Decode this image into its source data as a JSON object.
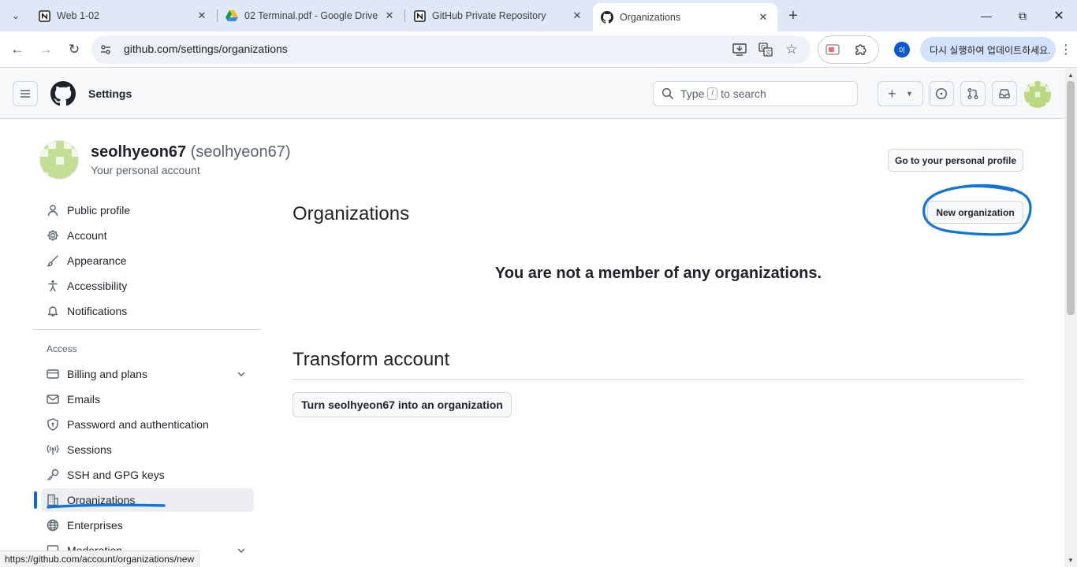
{
  "browser": {
    "tabs": [
      {
        "label": "Web 1-02",
        "icon": "notion-icon"
      },
      {
        "label": "02 Terminal.pdf - Google Drive",
        "icon": "google-drive-icon"
      },
      {
        "label": "GitHub Private Repository",
        "icon": "notion-icon"
      },
      {
        "label": "Organizations",
        "icon": "github-icon",
        "active": true
      }
    ],
    "url": "github.com/settings/organizations",
    "profile_initial": "이",
    "update_label": "다시 실행하여 업데이트하세요.",
    "status_url": "https://github.com/account/organizations/new"
  },
  "header": {
    "title": "Settings",
    "search_prefix": "Type",
    "search_key": "/",
    "search_suffix": "to search"
  },
  "profile": {
    "username": "seolhyeon67",
    "handle": "(seolhyeon67)",
    "subtitle": "Your personal account",
    "go_profile_label": "Go to your personal profile"
  },
  "sidebar": {
    "items": [
      {
        "label": "Public profile",
        "icon": "person-icon"
      },
      {
        "label": "Account",
        "icon": "gear-icon"
      },
      {
        "label": "Appearance",
        "icon": "paintbrush-icon"
      },
      {
        "label": "Accessibility",
        "icon": "accessibility-icon"
      },
      {
        "label": "Notifications",
        "icon": "bell-icon"
      }
    ],
    "access_heading": "Access",
    "access_items": [
      {
        "label": "Billing and plans",
        "icon": "credit-card-icon",
        "expandable": true
      },
      {
        "label": "Emails",
        "icon": "mail-icon"
      },
      {
        "label": "Password and authentication",
        "icon": "shield-lock-icon"
      },
      {
        "label": "Sessions",
        "icon": "broadcast-icon"
      },
      {
        "label": "SSH and GPG keys",
        "icon": "key-icon"
      },
      {
        "label": "Organizations",
        "icon": "organization-icon",
        "selected": true
      },
      {
        "label": "Enterprises",
        "icon": "globe-icon"
      },
      {
        "label": "Moderation",
        "icon": "report-icon",
        "expandable": true
      }
    ]
  },
  "main": {
    "heading": "Organizations",
    "new_org_label": "New organization",
    "empty_message": "You are not a member of any organizations.",
    "transform_heading": "Transform account",
    "transform_button": "Turn seolhyeon67 into an organization"
  },
  "colors": {
    "accent": "#0969da",
    "annotation": "#1473d6"
  }
}
